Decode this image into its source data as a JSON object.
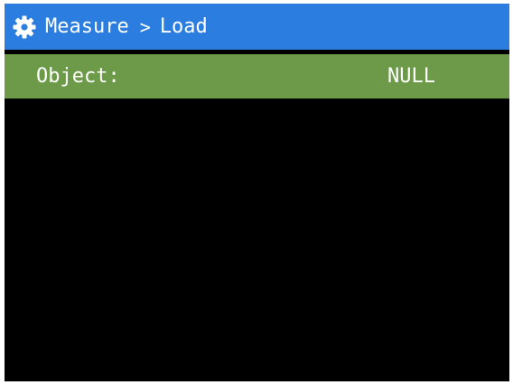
{
  "header": {
    "icon": "gear-icon",
    "crumbs": [
      "Measure",
      "Load"
    ],
    "separator": ">",
    "color": "#2b7ee0"
  },
  "row": {
    "label": "Object:",
    "value": "NULL",
    "color": "#6c9a49"
  }
}
